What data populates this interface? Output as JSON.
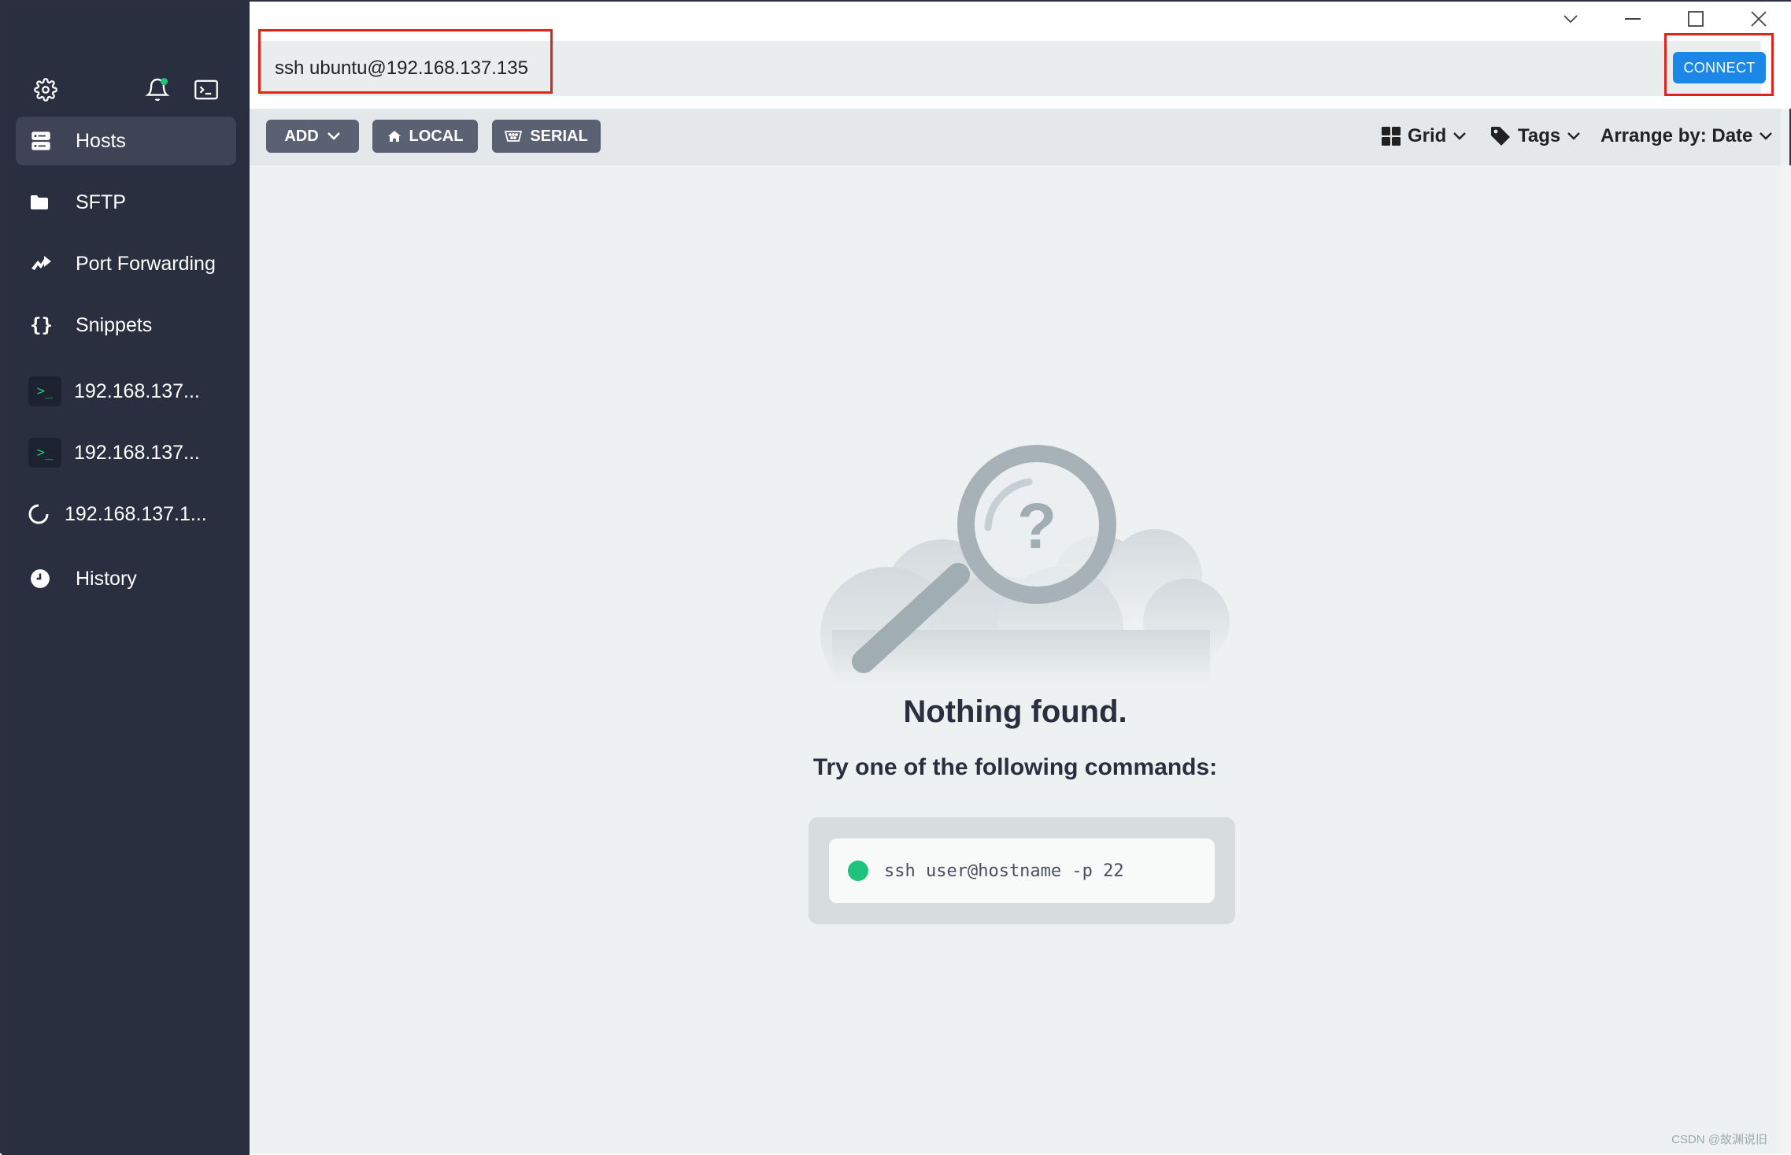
{
  "sidebar": {
    "items": [
      {
        "label": "Hosts",
        "icon": "hosts-icon"
      },
      {
        "label": "SFTP",
        "icon": "folder-icon"
      },
      {
        "label": "Port Forwarding",
        "icon": "port-forwarding-icon"
      },
      {
        "label": "Snippets",
        "icon": "snippets-icon"
      }
    ],
    "sessions": [
      {
        "label": "192.168.137...",
        "icon": "terminal-icon"
      },
      {
        "label": "192.168.137...",
        "icon": "terminal-icon"
      },
      {
        "label": "192.168.137.1...",
        "icon": "loading-spinner-icon"
      }
    ],
    "history_label": "History"
  },
  "search": {
    "value": "ssh ubuntu@192.168.137.135"
  },
  "connect_label": "CONNECT",
  "toolbar": {
    "add_label": "ADD",
    "local_label": "LOCAL",
    "serial_label": "SERIAL",
    "grid_label": "Grid",
    "tags_label": "Tags",
    "arrange_label": "Arrange by: Date"
  },
  "empty_state": {
    "title": "Nothing found.",
    "subtitle": "Try one of the following commands:",
    "command": "ssh user@hostname -p 22"
  },
  "watermark": "CSDN @故渊说旧",
  "colors": {
    "sidebar_bg": "#2a2f3f",
    "accent_blue": "#1b87e6",
    "status_green": "#1fc27a",
    "highlight_red": "#e2231a"
  }
}
